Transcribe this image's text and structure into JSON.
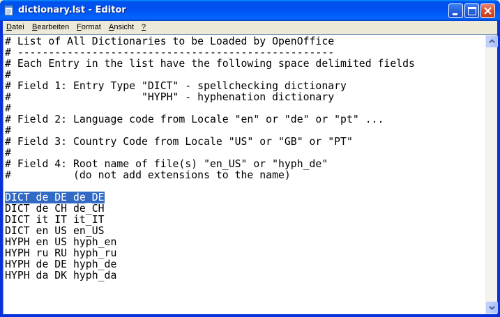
{
  "window": {
    "title": "dictionary.lst - Editor",
    "colors": {
      "titlebar": "#0054e3",
      "selection": "#316ac5"
    },
    "icons": {
      "app": "notepad-icon",
      "minimize": "minimize-icon",
      "maximize": "maximize-icon",
      "close": "close-icon"
    }
  },
  "menu": [
    {
      "label": "Datei",
      "mnemonic": "D"
    },
    {
      "label": "Bearbeiten",
      "mnemonic": "B"
    },
    {
      "label": "Format",
      "mnemonic": "F"
    },
    {
      "label": "Ansicht",
      "mnemonic": "A"
    },
    {
      "label": "?",
      "mnemonic": "?"
    }
  ],
  "document": {
    "lines": [
      "# List of All Dictionaries to be Loaded by OpenOffice",
      "# ---------------------------------------------------",
      "# Each Entry in the list have the following space delimited fields",
      "#",
      "# Field 1: Entry Type \"DICT\" - spellchecking dictionary",
      "#                     \"HYPH\" - hyphenation dictionary",
      "#",
      "# Field 2: Language code from Locale \"en\" or \"de\" or \"pt\" ...",
      "#",
      "# Field 3: Country Code from Locale \"US\" or \"GB\" or \"PT\"",
      "#",
      "# Field 4: Root name of file(s) \"en_US\" or \"hyph_de\"",
      "#          (do not add extensions to the name)",
      "",
      "DICT de DE de_DE",
      "DICT de CH de_CH",
      "DICT it IT it_IT",
      "DICT en US en_US",
      "HYPH en US hyph_en",
      "HYPH ru RU hyph_ru",
      "HYPH de DE hyph_de",
      "HYPH da DK hyph_da"
    ],
    "selected_line_index": 14
  },
  "scrollbar": {
    "up_icon": "arrow-up-icon",
    "down_icon": "arrow-down-icon"
  }
}
